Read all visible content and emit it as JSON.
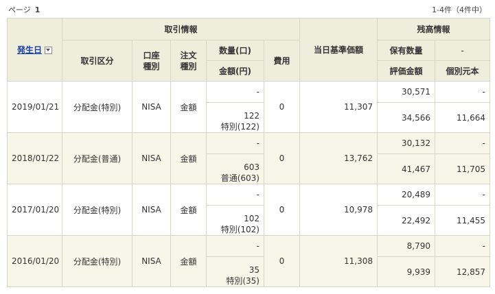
{
  "pager": {
    "label": "ページ",
    "page": "1",
    "count": "1-4件（4件中）"
  },
  "headers": {
    "date": "発生日",
    "trade_info": "取引情報",
    "trade_type": "取引区分",
    "account_type": "口座\n種別",
    "order_type": "注文\n種別",
    "quantity": "数量(口)",
    "amount": "金額(円)",
    "fee": "費用",
    "nav": "当日基準価額",
    "balance_info": "残高情報",
    "holding_qty": "保有数量",
    "holding_qty_value": "-",
    "valuation": "評価金額",
    "unit_cost": "個別元本"
  },
  "rows": [
    {
      "date": "2019/01/21",
      "type": "分配金(特別)",
      "account": "NISA",
      "order": "金額",
      "quantity": "-",
      "amount": "122",
      "amount_detail": "特別(122)",
      "fee": "0",
      "nav": "11,307",
      "holding": "30,571",
      "holding_right": "-",
      "valuation": "34,566",
      "unit_cost": "11,664"
    },
    {
      "date": "2018/01/22",
      "type": "分配金(普通)",
      "account": "NISA",
      "order": "金額",
      "quantity": "-",
      "amount": "603",
      "amount_detail": "普通(603)",
      "fee": "0",
      "nav": "13,762",
      "holding": "30,132",
      "holding_right": "-",
      "valuation": "41,467",
      "unit_cost": "11,705"
    },
    {
      "date": "2017/01/20",
      "type": "分配金(特別)",
      "account": "NISA",
      "order": "金額",
      "quantity": "-",
      "amount": "102",
      "amount_detail": "特別(102)",
      "fee": "0",
      "nav": "10,978",
      "holding": "20,489",
      "holding_right": "-",
      "valuation": "22,492",
      "unit_cost": "11,455"
    },
    {
      "date": "2016/01/20",
      "type": "分配金(特別)",
      "account": "NISA",
      "order": "金額",
      "quantity": "-",
      "amount": "35",
      "amount_detail": "特別(35)",
      "fee": "0",
      "nav": "11,308",
      "holding": "8,790",
      "holding_right": "-",
      "valuation": "9,939",
      "unit_cost": "12,857"
    }
  ]
}
